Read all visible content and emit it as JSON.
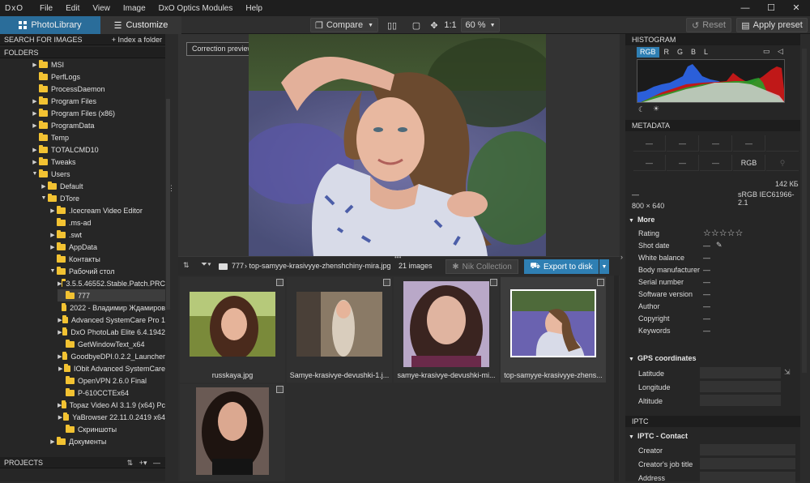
{
  "menu": {
    "logo": "DxO",
    "items": [
      "File",
      "Edit",
      "View",
      "Image",
      "DxO Optics Modules",
      "Help"
    ],
    "min": "—",
    "max": "☐",
    "close": "✕"
  },
  "toolbar": {
    "tab_library": "PhotoLibrary",
    "tab_customize": "Customize",
    "compare": "Compare",
    "one_to_one": "1:1",
    "zoom": "60 %",
    "reset": "Reset",
    "apply_preset": "Apply preset"
  },
  "left": {
    "search": "SEARCH FOR IMAGES",
    "index": "+ Index a folder",
    "folders": "FOLDERS",
    "projects": "PROJECTS",
    "tree": [
      {
        "label": "MSI",
        "indent": 0,
        "arrow": "▶"
      },
      {
        "label": "PerfLogs",
        "indent": 0,
        "arrow": ""
      },
      {
        "label": "ProcessDaemon",
        "indent": 0,
        "arrow": ""
      },
      {
        "label": "Program Files",
        "indent": 0,
        "arrow": "▶"
      },
      {
        "label": "Program Files (x86)",
        "indent": 0,
        "arrow": "▶"
      },
      {
        "label": "ProgramData",
        "indent": 0,
        "arrow": "▶"
      },
      {
        "label": "Temp",
        "indent": 0,
        "arrow": ""
      },
      {
        "label": "TOTALCMD10",
        "indent": 0,
        "arrow": "▶"
      },
      {
        "label": "Tweaks",
        "indent": 0,
        "arrow": "▶"
      },
      {
        "label": "Users",
        "indent": 0,
        "arrow": "▼"
      },
      {
        "label": "Default",
        "indent": 1,
        "arrow": "▶"
      },
      {
        "label": "DTore",
        "indent": 1,
        "arrow": "▼"
      },
      {
        "label": ".Icecream Video Editor",
        "indent": 2,
        "arrow": "▶"
      },
      {
        "label": ".ms-ad",
        "indent": 2,
        "arrow": ""
      },
      {
        "label": ".swt",
        "indent": 2,
        "arrow": "▶"
      },
      {
        "label": "AppData",
        "indent": 2,
        "arrow": "▶"
      },
      {
        "label": "Контакты",
        "indent": 2,
        "arrow": ""
      },
      {
        "label": "Рабочий стол",
        "indent": 2,
        "arrow": "▼"
      },
      {
        "label": "3.5.5.46552.Stable.Patch.PRC",
        "indent": 3,
        "arrow": "▶"
      },
      {
        "label": "777",
        "indent": 3,
        "arrow": "",
        "selected": true
      },
      {
        "label": "2022 - Владимир Ждамиров",
        "indent": 3,
        "arrow": ""
      },
      {
        "label": "Advanced SystemCare Pro 1",
        "indent": 3,
        "arrow": "▶"
      },
      {
        "label": "DxO PhotoLab Elite 6.4.1942",
        "indent": 3,
        "arrow": "▶"
      },
      {
        "label": "GetWindowText_x64",
        "indent": 3,
        "arrow": ""
      },
      {
        "label": "GoodbyeDPI.0.2.2_Launcher",
        "indent": 3,
        "arrow": "▶"
      },
      {
        "label": "IObit Advanced SystemCare",
        "indent": 3,
        "arrow": "▶"
      },
      {
        "label": "OpenVPN 2.6.0 Final",
        "indent": 3,
        "arrow": ""
      },
      {
        "label": "P-610CCTEx64",
        "indent": 3,
        "arrow": ""
      },
      {
        "label": "Topaz Video AI 3.1.9 (x64) Pc",
        "indent": 3,
        "arrow": "▶"
      },
      {
        "label": "YaBrowser 22.11.0.2419 x64",
        "indent": 3,
        "arrow": "▶"
      },
      {
        "label": "Скриншоты",
        "indent": 3,
        "arrow": ""
      },
      {
        "label": "Документы",
        "indent": 2,
        "arrow": "▶"
      }
    ]
  },
  "viewer": {
    "correction_preview": "Correction preview"
  },
  "filmstrip": {
    "folder": "777",
    "file": "top-samyye-krasivyye-zhenshchiny-mira.jpg",
    "count": "21 images",
    "nik": "Nik Collection",
    "export": "Export to disk",
    "thumbs": [
      {
        "caption": "russkaya.jpg"
      },
      {
        "caption": "Samye-krasivye-devushki-1.j..."
      },
      {
        "caption": "samye-krasivye-devushki-mi..."
      },
      {
        "caption": "top-samyye-krasivyye-zhens..."
      },
      {
        "caption": ""
      }
    ]
  },
  "right": {
    "histogram": "HISTOGRAM",
    "hist_channels": [
      "RGB",
      "R",
      "G",
      "B",
      "L"
    ],
    "metadata": "METADATA",
    "grid_row1": [
      "—",
      "—",
      "—",
      "—"
    ],
    "grid_row2": [
      "—",
      "—",
      "—",
      "RGB"
    ],
    "size": "142 КБ",
    "dash": "—",
    "profile": "sRGB IEC61966-2.1",
    "dimensions": "800 × 640",
    "more": "More",
    "fields": [
      {
        "label": "Rating",
        "value": "☆☆☆☆☆"
      },
      {
        "label": "Shot date",
        "value": "—"
      },
      {
        "label": "White balance",
        "value": "—"
      },
      {
        "label": "Body manufacturer",
        "value": "—"
      },
      {
        "label": "Serial number",
        "value": "—"
      },
      {
        "label": "Software version",
        "value": "—"
      },
      {
        "label": "Author",
        "value": "—"
      },
      {
        "label": "Copyright",
        "value": "—"
      },
      {
        "label": "Keywords",
        "value": "—"
      }
    ],
    "gps": "GPS coordinates",
    "gps_fields": [
      "Latitude",
      "Longitude",
      "Altitude"
    ],
    "iptc": "IPTC",
    "iptc_contact": "IPTC - Contact",
    "iptc_fields": [
      "Creator",
      "Creator's job title",
      "Address"
    ]
  },
  "colors": {
    "accent": "#2f7fb3",
    "folder": "#f2c232"
  }
}
